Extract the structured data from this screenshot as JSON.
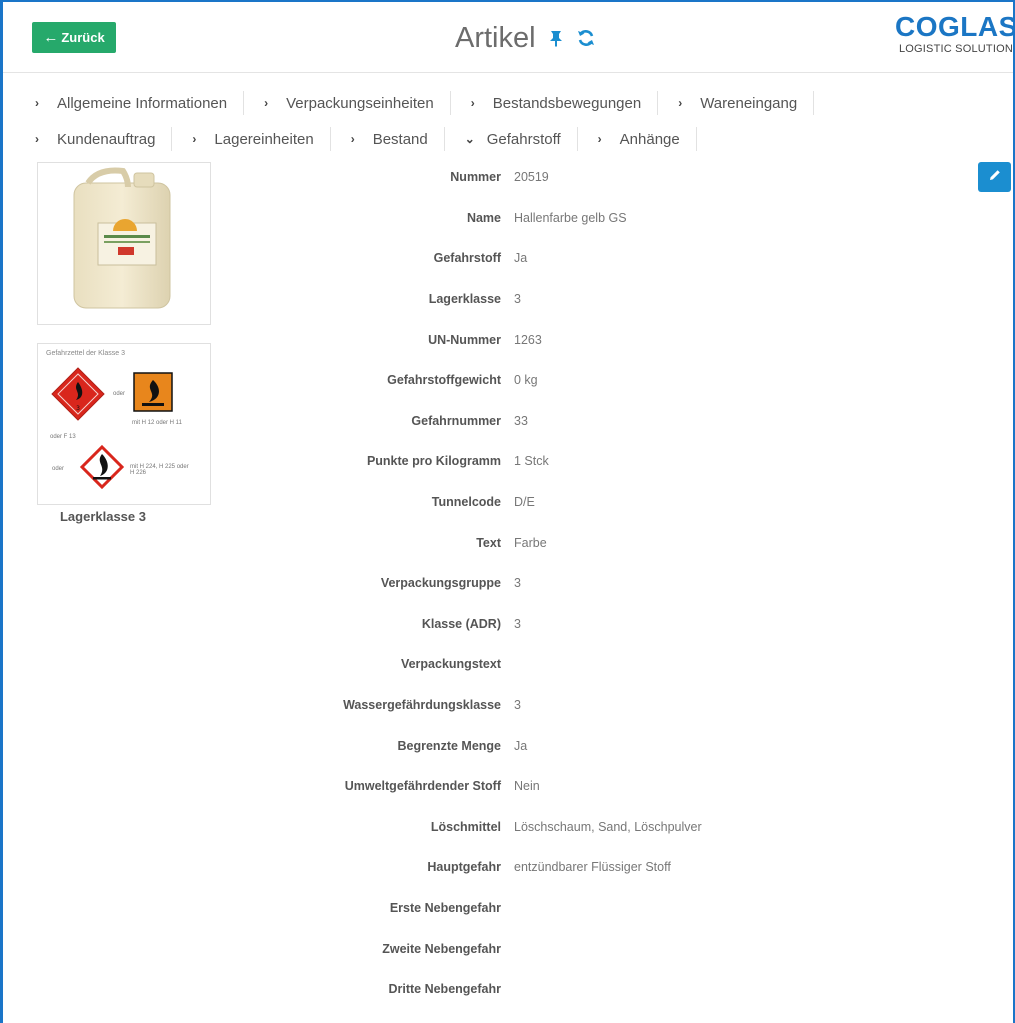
{
  "header": {
    "back_label": "Zurück",
    "title": "Artikel",
    "logo_main": "COGLAS",
    "logo_sub": "LOGISTIC SOLUTION",
    "icons": [
      "pin-icon",
      "refresh-icon"
    ]
  },
  "tabs": {
    "row1": [
      {
        "label": "Allgemeine Informationen",
        "chevron": "›"
      },
      {
        "label": "Verpackungseinheiten",
        "chevron": "›"
      },
      {
        "label": "Bestandsbewegungen",
        "chevron": "›"
      },
      {
        "label": "Wareneingang",
        "chevron": "›"
      }
    ],
    "row2": [
      {
        "label": "Kundenauftrag",
        "chevron": "›"
      },
      {
        "label": "Lagereinheiten",
        "chevron": "›"
      },
      {
        "label": "Bestand",
        "chevron": "›"
      },
      {
        "label": "Gefahrstoff",
        "chevron": "⌄"
      },
      {
        "label": "Anhänge",
        "chevron": "›"
      }
    ]
  },
  "images": {
    "hazard_title": "Gefahrzettel der Klasse 3",
    "hazard_caption": "Lagerklasse 3",
    "small_texts": {
      "oder1": "oder",
      "code1": "mit H 12 oder H 11",
      "oderf": "oder F 13",
      "oder2": "oder",
      "code2": "mit H 224, H 225 oder H 226"
    }
  },
  "details": [
    {
      "label": "Nummer",
      "value": "20519"
    },
    {
      "label": "Name",
      "value": "Hallenfarbe gelb GS"
    },
    {
      "label": "Gefahrstoff",
      "value": "Ja"
    },
    {
      "label": "Lagerklasse",
      "value": "3"
    },
    {
      "label": "UN-Nummer",
      "value": "1263"
    },
    {
      "label": "Gefahrstoffgewicht",
      "value": "0 kg"
    },
    {
      "label": "Gefahrnummer",
      "value": "33"
    },
    {
      "label": "Punkte pro Kilogramm",
      "value": "1 Stck"
    },
    {
      "label": "Tunnelcode",
      "value": "D/E"
    },
    {
      "label": "Text",
      "value": "Farbe"
    },
    {
      "label": "Verpackungsgruppe",
      "value": "3"
    },
    {
      "label": "Klasse (ADR)",
      "value": "3"
    },
    {
      "label": "Verpackungstext",
      "value": ""
    },
    {
      "label": "Wassergefährdungsklasse",
      "value": "3"
    },
    {
      "label": "Begrenzte Menge",
      "value": "Ja"
    },
    {
      "label": "Umweltgefährdender Stoff",
      "value": "Nein"
    },
    {
      "label": "Löschmittel",
      "value": "Löschschaum, Sand, Löschpulver"
    },
    {
      "label": "Hauptgefahr",
      "value": "entzündbarer Flüssiger Stoff"
    },
    {
      "label": "Erste Nebengefahr",
      "value": ""
    },
    {
      "label": "Zweite Nebengefahr",
      "value": ""
    },
    {
      "label": "Dritte Nebengefahr",
      "value": ""
    }
  ],
  "colors": {
    "accent_green": "#26a96b",
    "accent_blue": "#1b8ed0",
    "logo_blue": "#1b76c4",
    "frame_blue": "#1a75c8"
  },
  "edit_icon": "pencil-icon"
}
